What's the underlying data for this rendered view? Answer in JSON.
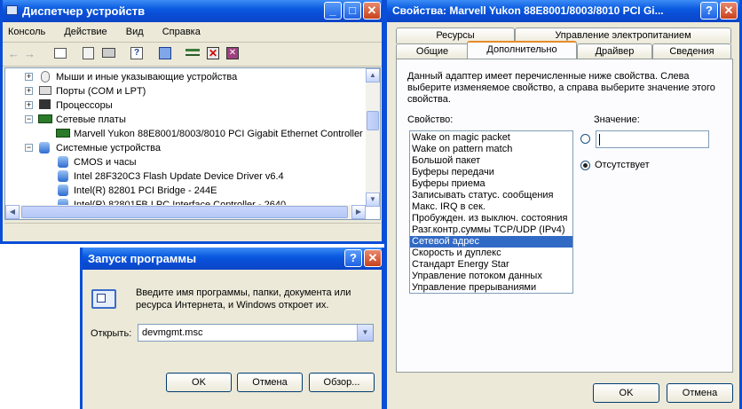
{
  "device_manager": {
    "title": "Диспетчер устройств",
    "menu": [
      "Консоль",
      "Действие",
      "Вид",
      "Справка"
    ],
    "tree": [
      {
        "label": "Мыши и иные указывающие устройства",
        "expander": "+"
      },
      {
        "label": "Порты (COM и LPT)",
        "expander": "+"
      },
      {
        "label": "Процессоры",
        "expander": "+"
      },
      {
        "label": "Сетевые платы",
        "expander": "−"
      },
      {
        "label": "Marvell Yukon 88E8001/8003/8010 PCI Gigabit Ethernet Controller",
        "expander": ""
      },
      {
        "label": "Системные устройства",
        "expander": "−"
      },
      {
        "label": "CMOS и часы",
        "expander": ""
      },
      {
        "label": "Intel 28F320C3 Flash Update Device Driver v6.4",
        "expander": ""
      },
      {
        "label": "Intel(R) 82801 PCI Bridge - 244E",
        "expander": ""
      },
      {
        "label": "Intel(R) 82801FB LPC Interface Controller - 2640",
        "expander": ""
      }
    ]
  },
  "properties": {
    "title": "Свойства: Marvell Yukon 88E8001/8003/8010 PCI Gi...",
    "tabs_back": [
      "Ресурсы",
      "Управление электропитанием"
    ],
    "tabs_front": [
      "Общие",
      "Дополнительно",
      "Драйвер",
      "Сведения"
    ],
    "active_tab": "Дополнительно",
    "description": "Данный адаптер имеет перечисленные ниже свойства. Слева выберите изменяемое свойство, а справа выберите значение этого свойства.",
    "property_label": "Свойство:",
    "value_label": "Значение:",
    "value_input": "",
    "absent_label": "Отсутствует",
    "properties_list": [
      "Wake on magic packet",
      "Wake on pattern match",
      "Большой пакет",
      "Буферы передачи",
      "Буферы приема",
      "Записывать статус. сообщения",
      "Макс. IRQ в сек.",
      "Пробужден. из выключ. состояния",
      "Разг.контр.суммы TCP/UDP (IPv4)",
      "Сетевой адрес",
      "Скорость и дуплекс",
      "Стандарт Energy Star",
      "Управление потоком данных",
      "Управление прерываниями"
    ],
    "selected_property": "Сетевой адрес",
    "ok_label": "OK",
    "cancel_label": "Отмена"
  },
  "run_dialog": {
    "title": "Запуск программы",
    "description": "Введите имя программы, папки, документа или ресурса Интернета, и Windows откроет их.",
    "open_label": "Открыть:",
    "open_value": "devmgmt.msc",
    "ok_label": "OK",
    "cancel_label": "Отмена",
    "browse_label": "Обзор..."
  },
  "title_buttons": {
    "help": "?",
    "close": "✕",
    "minimize": "_",
    "maximize": "□"
  },
  "colors": {
    "titlebar": "#0a4ed8",
    "face": "#ece9d8",
    "selection": "#316ac5"
  }
}
